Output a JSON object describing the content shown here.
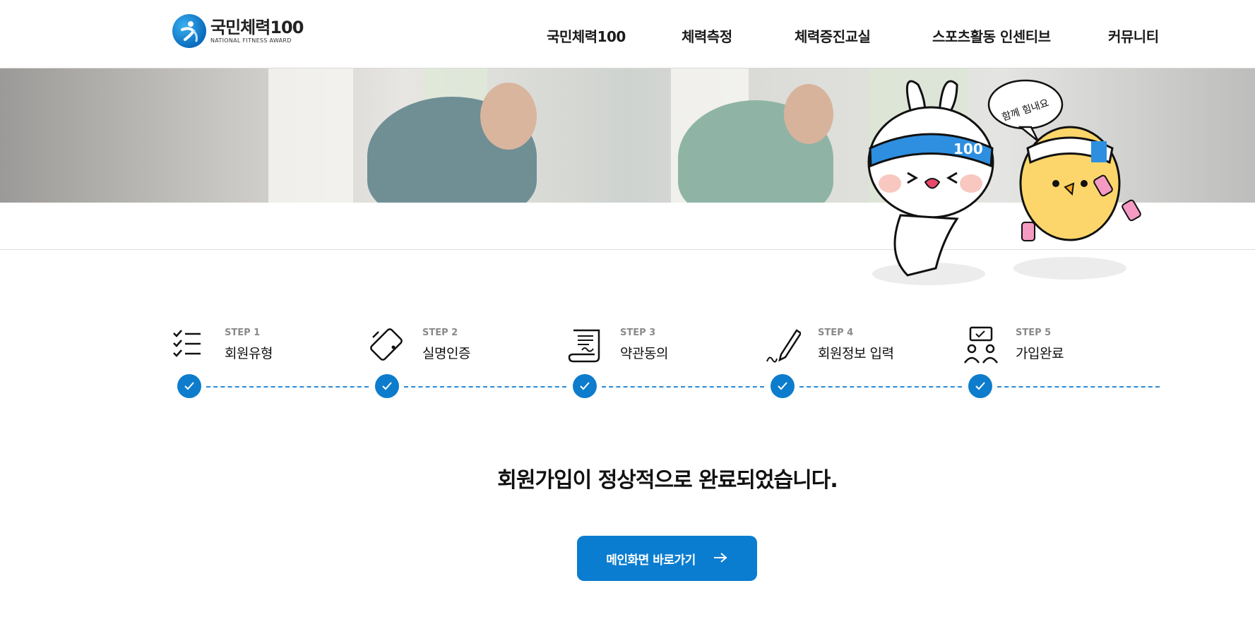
{
  "header": {
    "logo_title": "국민체력100",
    "logo_sub": "NATIONAL FITNESS AWARD",
    "nav": [
      "국민체력100",
      "체력측정",
      "체력증진교실",
      "스포츠활동 인센티브",
      "커뮤니티"
    ]
  },
  "banner": {
    "speech_bubble": "함께 힘내요",
    "headband_number": "100"
  },
  "steps": [
    {
      "num": "STEP 1",
      "label": "회원유형",
      "icon": "checklist-icon",
      "completed": true
    },
    {
      "num": "STEP 2",
      "label": "실명인증",
      "icon": "phone-verify-icon",
      "completed": true
    },
    {
      "num": "STEP 3",
      "label": "약관동의",
      "icon": "contract-scroll-icon",
      "completed": true
    },
    {
      "num": "STEP 4",
      "label": "회원정보 입력",
      "icon": "pencil-sign-icon",
      "completed": true
    },
    {
      "num": "STEP 5",
      "label": "가입완료",
      "icon": "people-meeting-icon",
      "completed": true
    }
  ],
  "message": "회원가입이 정상적으로 완료되었습니다.",
  "button": {
    "label": "메인화면 바로가기",
    "icon": "arrow-right-icon"
  },
  "colors": {
    "accent": "#0b7dd0",
    "dashed_line": "#2b8bd6"
  }
}
